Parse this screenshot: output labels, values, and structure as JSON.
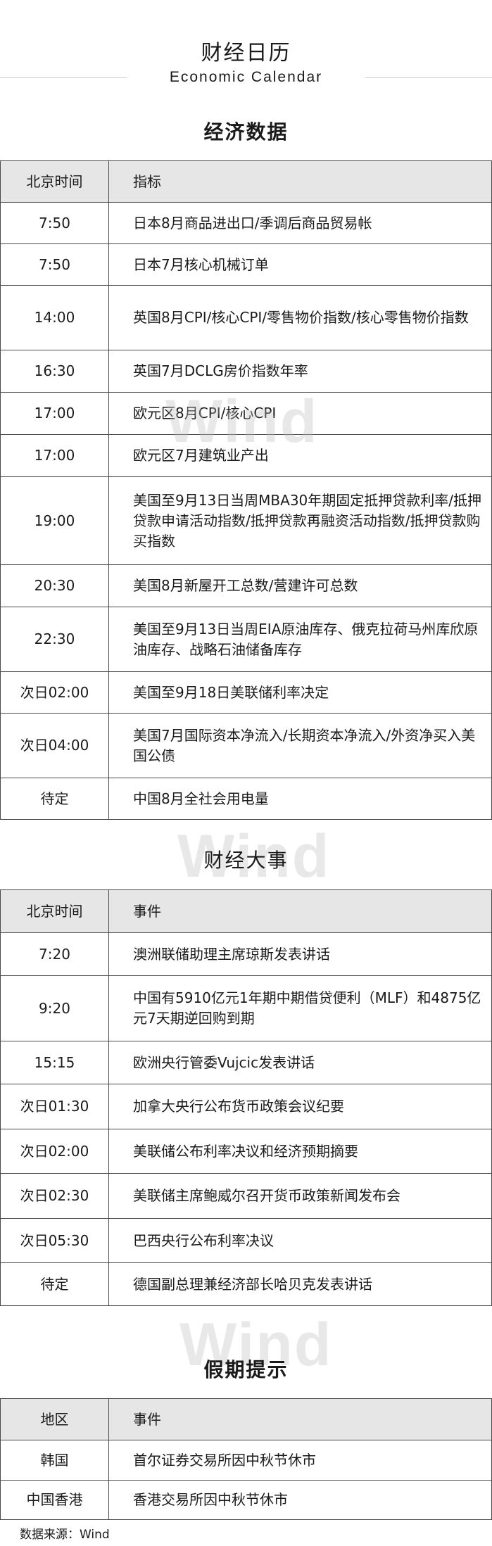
{
  "header": {
    "title": "财经日历",
    "subtitle": "Economic Calendar"
  },
  "economic_data": {
    "title": "经济数据",
    "col_time": "北京时间",
    "col_item": "指标",
    "rows": [
      {
        "time": "7:50",
        "item": "日本8月商品进出口/季调后商品贸易帐"
      },
      {
        "time": "7:50",
        "item": "日本7月核心机械订单"
      },
      {
        "time": "14:00",
        "item": "英国8月CPI/核心CPI/零售物价指数/核心零售物价指数"
      },
      {
        "time": "16:30",
        "item": "英国7月DCLG房价指数年率"
      },
      {
        "time": "17:00",
        "item": "欧元区8月CPI/核心CPI"
      },
      {
        "time": "17:00",
        "item": "欧元区7月建筑业产出"
      },
      {
        "time": "19:00",
        "item": "美国至9月13日当周MBA30年期固定抵押贷款利率/抵押贷款申请活动指数/抵押贷款再融资活动指数/抵押贷款购买指数"
      },
      {
        "time": "20:30",
        "item": "美国8月新屋开工总数/营建许可总数"
      },
      {
        "time": "22:30",
        "item": "美国至9月13日当周EIA原油库存、俄克拉荷马州库欣原油库存、战略石油储备库存"
      },
      {
        "time": "次日02:00",
        "item": "美国至9月18日美联储利率决定"
      },
      {
        "time": "次日04:00",
        "item": "美国7月国际资本净流入/长期资本净流入/外资净买入美国公债"
      },
      {
        "time": "待定",
        "item": "中国8月全社会用电量"
      }
    ]
  },
  "financial_events": {
    "title": "财经大事",
    "col_time": "北京时间",
    "col_item": "事件",
    "rows": [
      {
        "time": "7:20",
        "item": "澳洲联储助理主席琼斯发表讲话"
      },
      {
        "time": "9:20",
        "item": "中国有5910亿元1年期中期借贷便利（MLF）和4875亿元7天期逆回购到期"
      },
      {
        "time": "15:15",
        "item": "欧洲央行管委Vujcic发表讲话"
      },
      {
        "time": "次日01:30",
        "item": "加拿大央行公布货币政策会议纪要"
      },
      {
        "time": "次日02:00",
        "item": "美联储公布利率决议和经济预期摘要"
      },
      {
        "time": "次日02:30",
        "item": "美联储主席鲍威尔召开货币政策新闻发布会"
      },
      {
        "time": "次日05:30",
        "item": "巴西央行公布利率决议"
      },
      {
        "time": "待定",
        "item": "德国副总理兼经济部长哈贝克发表讲话"
      }
    ]
  },
  "holidays": {
    "title": "假期提示",
    "col_region": "地区",
    "col_item": "事件",
    "rows": [
      {
        "region": "韩国",
        "item": "首尔证券交易所因中秋节休市"
      },
      {
        "region": "中国香港",
        "item": "香港交易所因中秋节休市"
      }
    ]
  },
  "watermark": "Wind",
  "footer": {
    "source": "数据来源：Wind"
  }
}
